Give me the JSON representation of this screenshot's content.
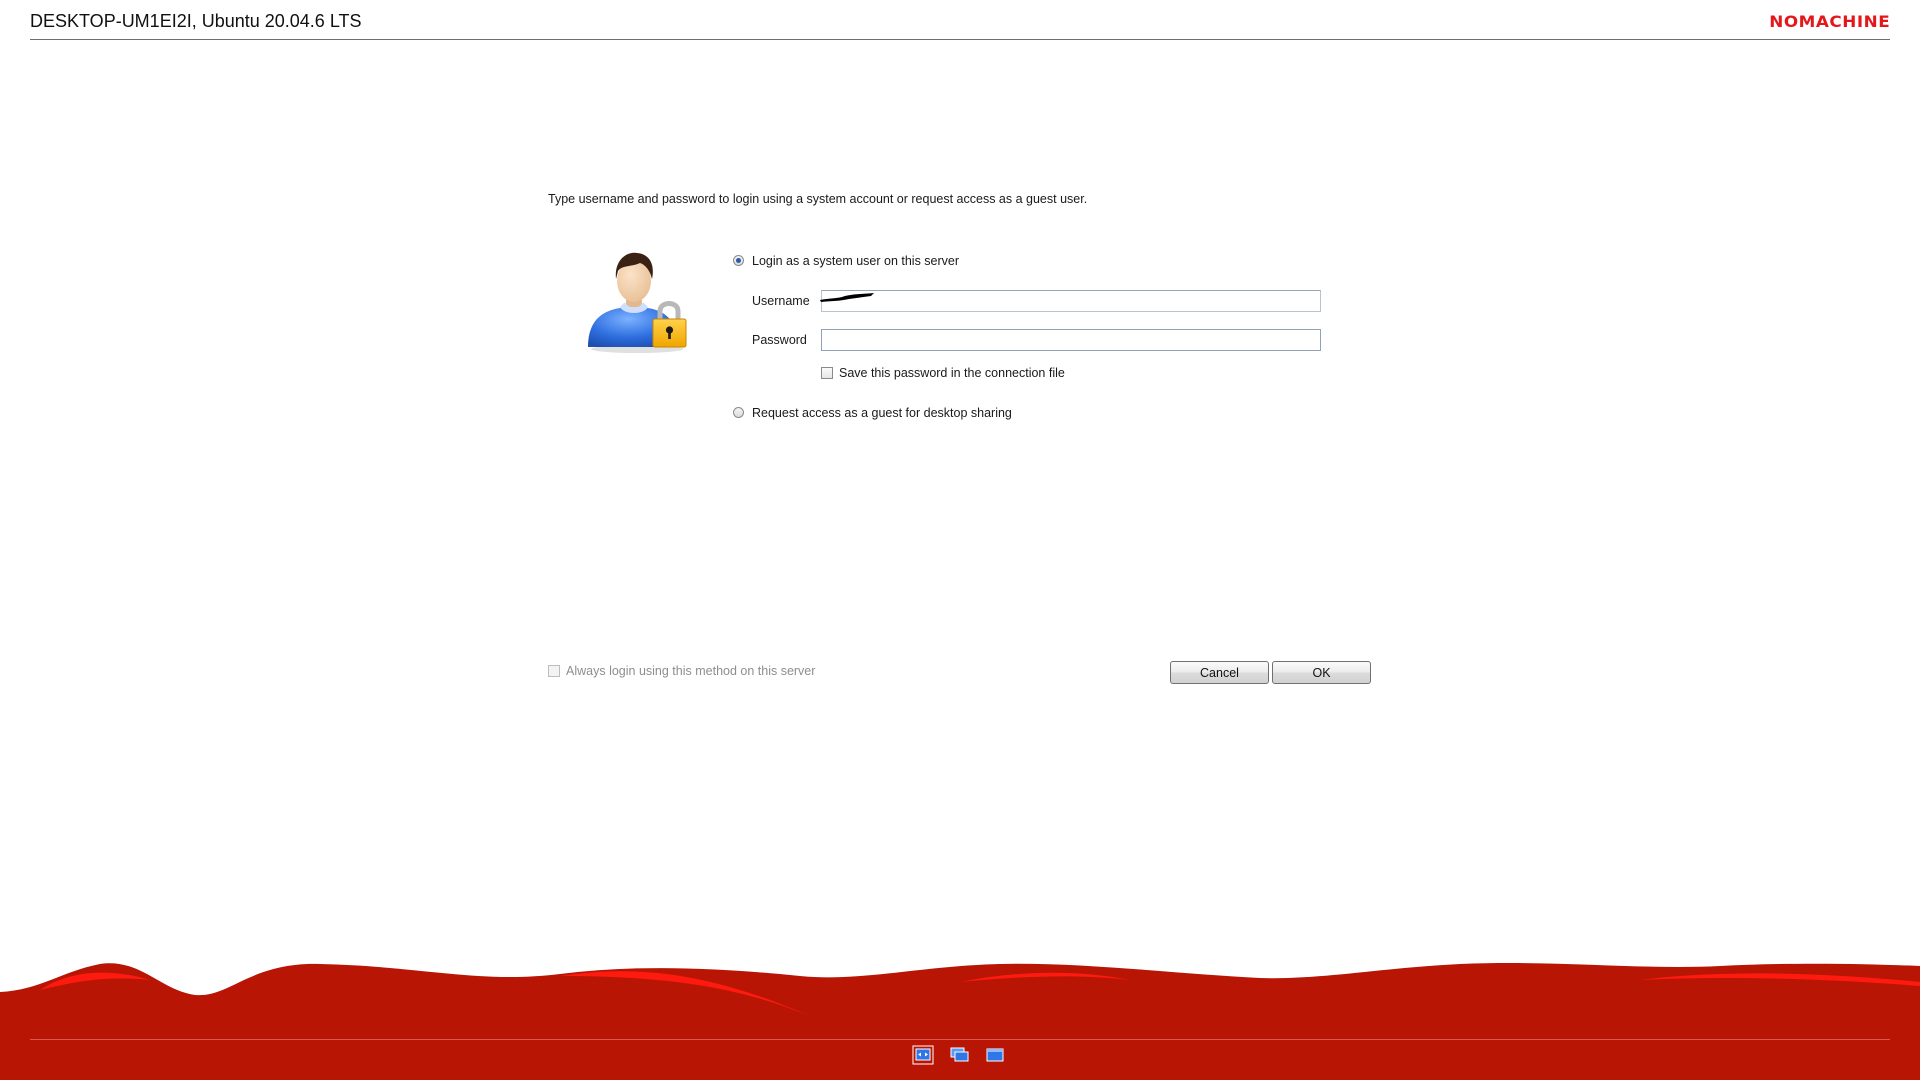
{
  "header": {
    "title": "DESKTOP-UM1EI2I, Ubuntu 20.04.6 LTS",
    "brand": "NOMACHINE"
  },
  "dialog": {
    "instruction": "Type username and password to login using a system account or request access as a guest user.",
    "option_system_user": {
      "label": "Login as a system user on this server",
      "selected": true
    },
    "username": {
      "label": "Username",
      "value": ""
    },
    "password": {
      "label": "Password",
      "value": ""
    },
    "save_password": {
      "label": "Save this password in the connection file",
      "checked": false
    },
    "option_guest": {
      "label": "Request access as a guest for desktop sharing",
      "selected": false
    },
    "always_login": {
      "label": "Always login using this method on this server",
      "checked": false,
      "enabled": false
    },
    "cancel_label": "Cancel",
    "ok_label": "OK"
  },
  "footer": {
    "icons": [
      "fit-to-window-icon",
      "resize-remote-screen-icon",
      "fullscreen-icon"
    ]
  },
  "colors": {
    "brand_red": "#e4171b",
    "footer_red": "#b81505",
    "accent_blue": "#2a5aa8"
  }
}
